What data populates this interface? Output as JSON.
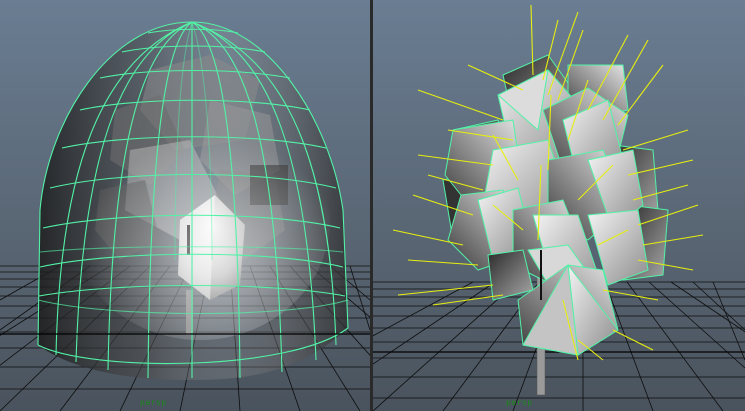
{
  "viewports": {
    "left": {
      "camera_label": "persp",
      "display_mode": "wireframe-on-shaded"
    },
    "right": {
      "camera_label": "persp",
      "display_mode": "wireframe-on-shaded",
      "show_normals": true
    }
  },
  "colors": {
    "background_top": "#6a7d92",
    "background_bottom": "#4a535d",
    "grid_line": "#0d0d0d",
    "grid_axis": "#000000",
    "wireframe_selected": "#52f2a6",
    "normals": "#e6ee10",
    "camera_label": "#1a8a1a",
    "mesh_light": "#f2f2f2",
    "mesh_dark": "#2e2e2e"
  }
}
